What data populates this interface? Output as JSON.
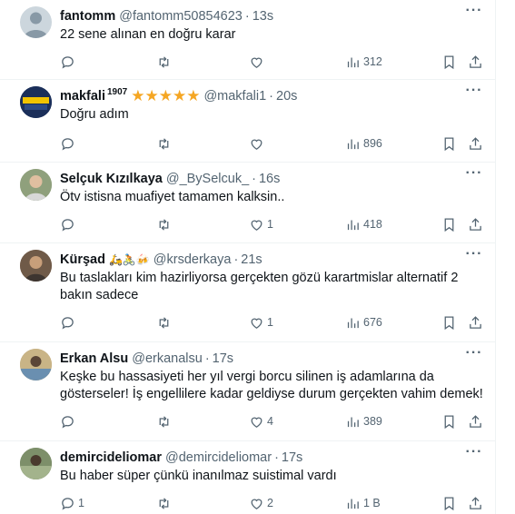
{
  "tweets": [
    {
      "name": "fantomm",
      "handle": "@fantomm50854623",
      "time": "13s",
      "text": "22 sene alınan en doğru karar",
      "replies": "",
      "likes": "",
      "views": "312",
      "avatar_color": "#aab8c2"
    },
    {
      "name": "makfali",
      "name_sup": "1907",
      "badge": "★★★★★",
      "handle": "@makfali1",
      "time": "20s",
      "text": "Doğru adım",
      "replies": "",
      "likes": "",
      "views": "896",
      "avatar_color": "#1b2f5a"
    },
    {
      "name": "Selçuk Kızılkaya",
      "handle": "@_BySelcuk_",
      "time": "16s",
      "text": "Ötv istisna muafiyet tamamen kalksin..",
      "replies": "",
      "likes": "1",
      "views": "418",
      "avatar_color": "#7a8a6a"
    },
    {
      "name": "Kürşad",
      "emoji": "🛵🚴🍻",
      "handle": "@krsderkaya",
      "time": "21s",
      "text": "Bu taslakları kim hazirliyorsa gerçekten gözü karartmislar alternatif 2 bakın sadece",
      "replies": "",
      "likes": "1",
      "views": "676",
      "avatar_color": "#8a6d55"
    },
    {
      "name": "Erkan Alsu",
      "handle": "@erkanalsu",
      "time": "17s",
      "text": "Keşke bu hassasiyeti her yıl vergi borcu silinen iş adamlarına da gösterseler! İş engellilere kadar geldiyse durum gerçekten vahim demek!",
      "replies": "",
      "likes": "4",
      "views": "389",
      "avatar_color": "#b9a06a"
    },
    {
      "name": "demircideliomar",
      "handle": "@demircideliomar",
      "time": "17s",
      "text": "Bu haber süper çünkü inanılmaz suistimal vardı",
      "replies": "1",
      "likes": "2",
      "views": "1 B",
      "avatar_color": "#6b7c5a"
    }
  ],
  "separator": "·",
  "more_label": "···"
}
